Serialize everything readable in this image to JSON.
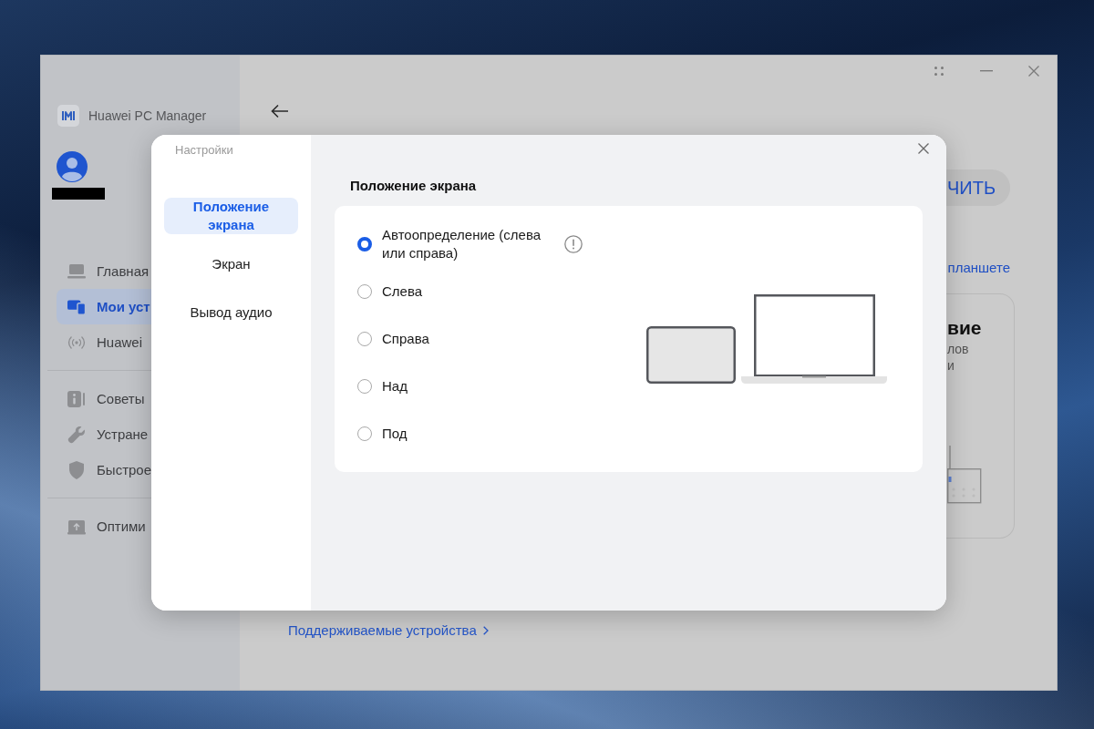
{
  "window": {
    "title": "Huawei PC Manager"
  },
  "sidebar": {
    "nav_groups": [
      [
        {
          "label": "Главная",
          "selected": false
        },
        {
          "label": "Мои уст",
          "selected": true
        },
        {
          "label": "Huawei",
          "selected": false
        }
      ],
      [
        {
          "label": "Советы",
          "selected": false
        },
        {
          "label": "Устране",
          "selected": false
        },
        {
          "label": "Быстрое",
          "selected": false
        }
      ],
      [
        {
          "label": "Оптими",
          "selected": false
        }
      ]
    ]
  },
  "main": {
    "action_button": "ЧИТЬ",
    "link": "планшете",
    "card": {
      "title": "вие",
      "lines": [
        "лов",
        "и"
      ]
    },
    "footer_link": "Поддерживаемые устройства"
  },
  "dialog": {
    "title": "Настройки",
    "nav": [
      {
        "label": "Положение экрана",
        "selected": true
      },
      {
        "label": "Экран",
        "selected": false
      },
      {
        "label": "Вывод аудио",
        "selected": false
      }
    ],
    "heading": "Положение экрана",
    "options": [
      {
        "label": "Автоопределение (слева или справа)",
        "selected": true,
        "info": true
      },
      {
        "label": "Слева",
        "selected": false
      },
      {
        "label": "Справа",
        "selected": false
      },
      {
        "label": "Над",
        "selected": false
      },
      {
        "label": "Под",
        "selected": false
      }
    ]
  }
}
